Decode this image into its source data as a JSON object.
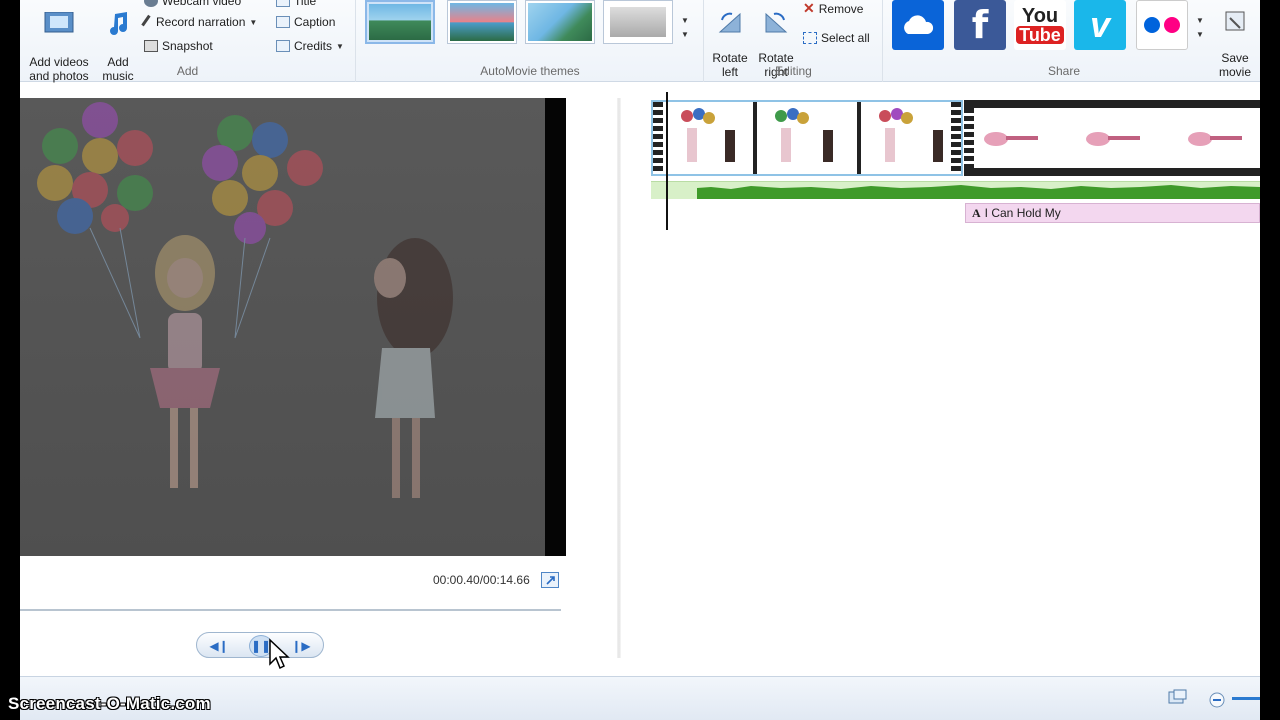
{
  "ribbon": {
    "add": {
      "label": "Add",
      "add_videos": "Add videos\nand photos",
      "add_music": "Add\nmusic",
      "webcam": "Webcam video",
      "record_narration": "Record narration",
      "snapshot": "Snapshot",
      "title": "Title",
      "caption": "Caption",
      "credits": "Credits"
    },
    "themes": {
      "label": "AutoMovie themes"
    },
    "editing": {
      "label": "Editing",
      "rotate_left": "Rotate\nleft",
      "rotate_right": "Rotate\nright",
      "remove": "Remove",
      "select_all": "Select all"
    },
    "share": {
      "label": "Share",
      "save_movie": "Save\nmovie",
      "youtube_top": "You",
      "youtube_bottom": "Tube",
      "facebook": "f"
    }
  },
  "player": {
    "time": "00:00.40/00:14.66"
  },
  "storyboard": {
    "caption_text": "I Can Hold My",
    "caption_icon": "A"
  },
  "watermark": "Screencast-O-Matic.com",
  "colors": {
    "onedrive": "#0a64d8",
    "facebook": "#3b5998",
    "youtube": "#d22",
    "vimeo": "#1ab7ea",
    "flickr_blue": "#0063dc",
    "flickr_pink": "#ff0084"
  }
}
